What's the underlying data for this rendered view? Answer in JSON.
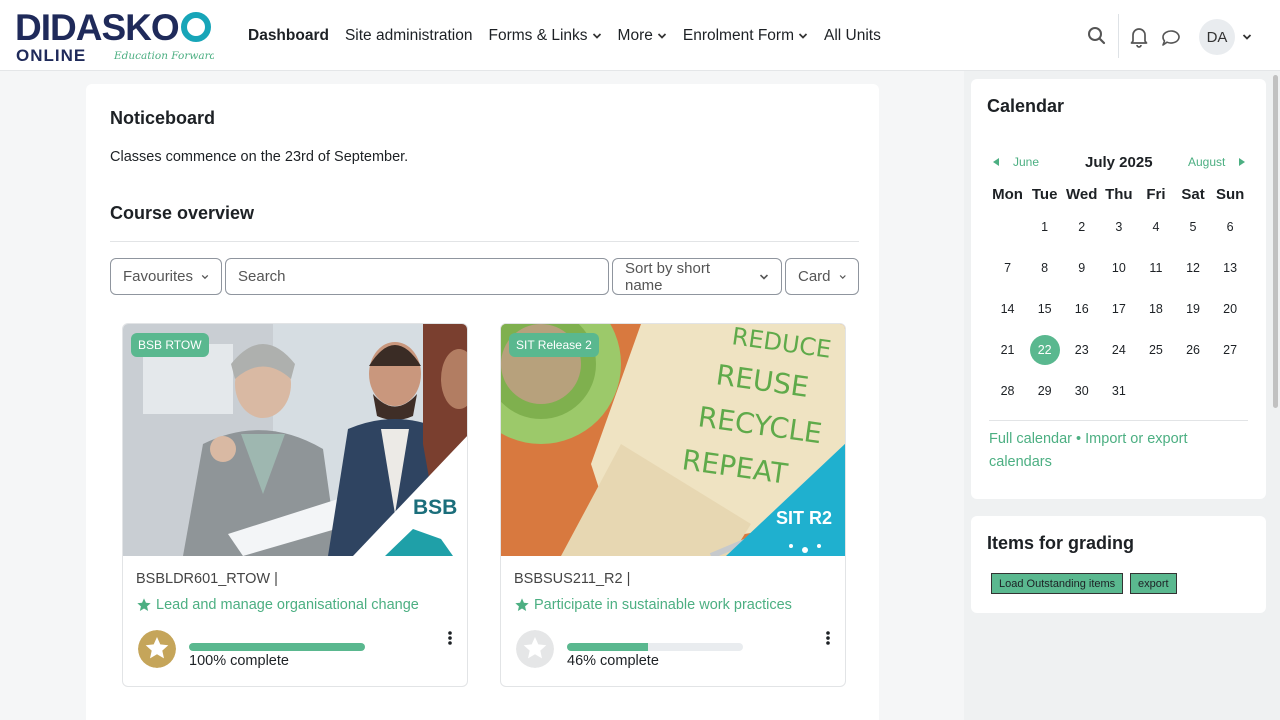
{
  "brand": {
    "name_top": "DIDASKO",
    "name_bottom": "ONLINE",
    "tagline": "Education Forward"
  },
  "nav": {
    "items": [
      {
        "label": "Dashboard",
        "active": true,
        "dropdown": false
      },
      {
        "label": "Site administration",
        "active": false,
        "dropdown": false
      },
      {
        "label": "Forms & Links",
        "active": false,
        "dropdown": true
      },
      {
        "label": "More",
        "active": false,
        "dropdown": true
      },
      {
        "label": "Enrolment Form",
        "active": false,
        "dropdown": true
      },
      {
        "label": "All Units",
        "active": false,
        "dropdown": false
      }
    ],
    "user_initials": "DA"
  },
  "noticeboard": {
    "title": "Noticeboard",
    "text": "Classes commence on the 23rd of September."
  },
  "course_overview": {
    "title": "Course overview",
    "filter_value": "Favourites",
    "search_placeholder": "Search",
    "sort_value": "Sort by short name",
    "view_value": "Card",
    "courses": [
      {
        "badge": "BSB RTOW",
        "image_label": "BSB",
        "shortname": "BSBLDR601_RTOW |",
        "fullname": "Lead and manage organisational change",
        "progress": 100,
        "progress_text": "100% complete"
      },
      {
        "badge": "SIT Release 2",
        "image_label": "SIT R2",
        "image_words": [
          "REDUCE",
          "REUSE",
          "RECYCLE",
          "REPEAT"
        ],
        "shortname": "BSBSUS211_R2 |",
        "fullname": "Participate in sustainable work practices",
        "progress": 46,
        "progress_text": "46% complete"
      }
    ]
  },
  "calendar": {
    "title": "Calendar",
    "prev": "June",
    "current": "July 2025",
    "next": "August",
    "weekdays": [
      "Mon",
      "Tue",
      "Wed",
      "Thu",
      "Fri",
      "Sat",
      "Sun"
    ],
    "weeks": [
      [
        "",
        "1",
        "2",
        "3",
        "4",
        "5",
        "6"
      ],
      [
        "7",
        "8",
        "9",
        "10",
        "11",
        "12",
        "13"
      ],
      [
        "14",
        "15",
        "16",
        "17",
        "18",
        "19",
        "20"
      ],
      [
        "21",
        "22",
        "23",
        "24",
        "25",
        "26",
        "27"
      ],
      [
        "28",
        "29",
        "30",
        "31",
        "",
        "",
        ""
      ]
    ],
    "today": "22",
    "link_full": "Full calendar",
    "link_separator": " • ",
    "link_import": "Import or export calendars"
  },
  "grading": {
    "title": "Items for grading",
    "load_btn": "Load Outstanding items",
    "export_btn": "export"
  },
  "colors": {
    "accent": "#5ab88f",
    "link": "#4caf82",
    "brand_dark": "#1f2a5a",
    "brand_teal": "#17a5b8"
  }
}
